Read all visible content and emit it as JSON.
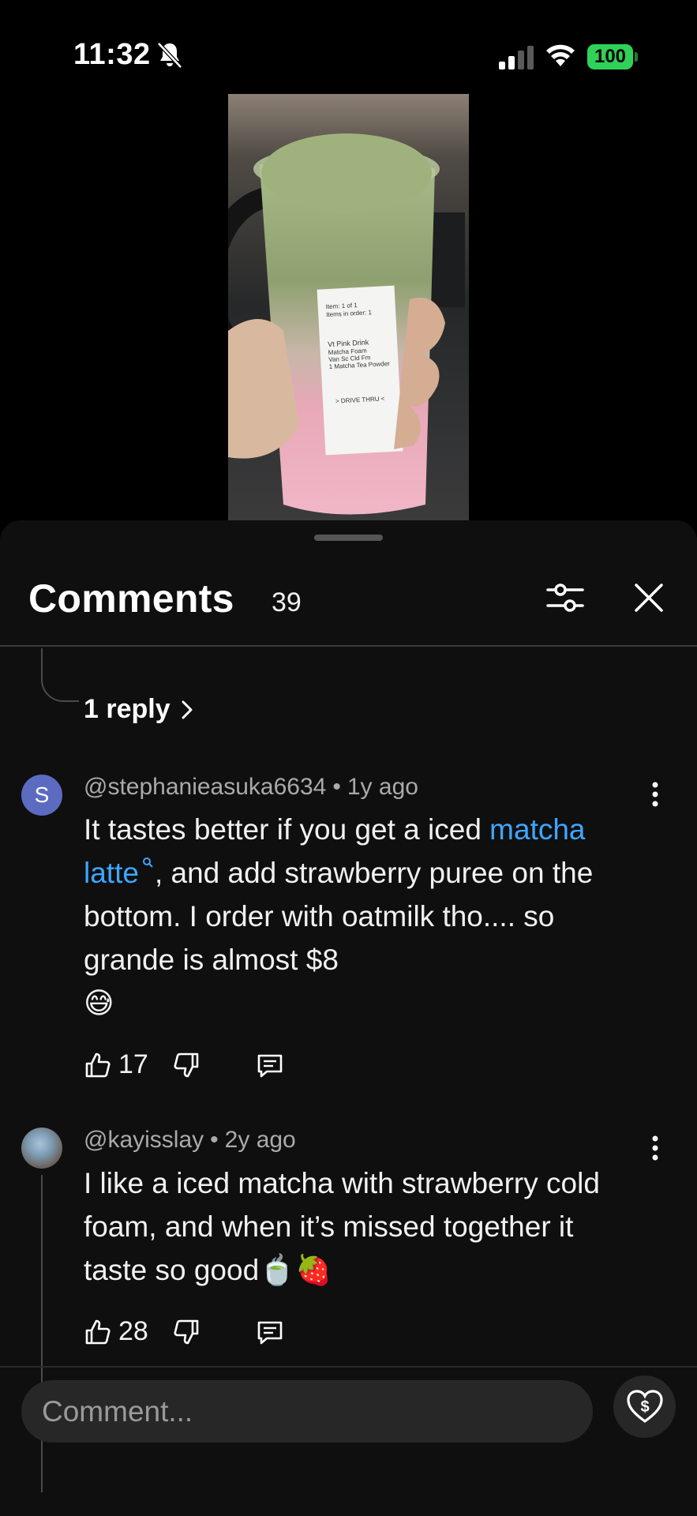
{
  "status_bar": {
    "time": "11:32",
    "battery": "100",
    "battery_color": "#30d158"
  },
  "video": {
    "receipt_lines": [
      "Item: 1 of 1",
      "Items in order: 1",
      "Vt Pink Drink",
      "Matcha Foam",
      "Van Sc Cld Fm",
      "1 Matcha Tea Powder",
      "> DRIVE THRU <"
    ]
  },
  "comments_sheet": {
    "title": "Comments",
    "count": "39",
    "reply_link": "1 reply",
    "comments": [
      {
        "avatar_letter": "S",
        "author": "@stephanieasuka6634",
        "age": "1y ago",
        "text_before": "It tastes better if you get a iced ",
        "link_text": "matcha latte",
        "text_after": ", and add strawberry puree on the bottom. I order with oatmilk tho.... so grande is almost $8",
        "emoji": "😅",
        "likes": "17"
      },
      {
        "author": "@kayisslay",
        "age": "2y ago",
        "text": "I like a iced matcha with strawberry cold foam, and when it’s missed together it taste so good🍵🍓",
        "likes": "28"
      }
    ],
    "composer": {
      "placeholder": "Comment..."
    }
  },
  "colors": {
    "sheet_bg": "#0f0f0f",
    "link": "#3ea6ff",
    "meta": "#aaaaaa",
    "avatar_s": "#5c6bc0"
  },
  "icons": [
    "bell-off-icon",
    "signal-icon",
    "wifi-icon",
    "filter-icon",
    "close-icon",
    "chevron-right-icon",
    "more-vert-icon",
    "thumbs-up-icon",
    "thumbs-down-icon",
    "reply-icon",
    "super-thanks-icon"
  ]
}
